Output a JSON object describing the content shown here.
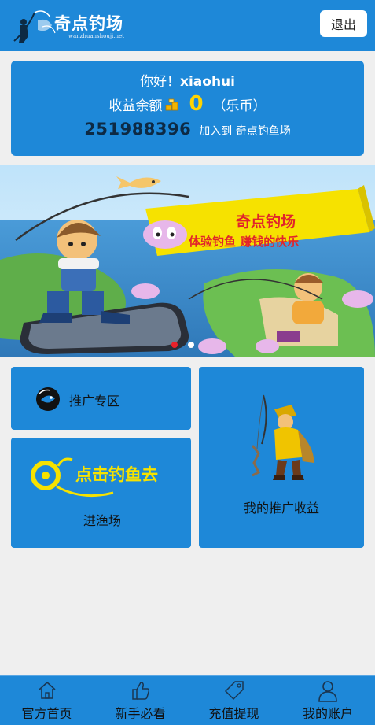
{
  "header": {
    "logo_text": "奇点钓场",
    "logo_subtext": "wanzhuanshouji.net",
    "logout_label": "退出"
  },
  "account": {
    "greeting_prefix": "你好！",
    "username": "xiaohui",
    "balance_label": "收益余额",
    "balance_value": "0",
    "balance_unit": "（乐币）",
    "invite_code": "251988396",
    "invite_text": "加入到 奇点钓鱼场"
  },
  "banner": {
    "headline": "奇点钓场",
    "slogan": "体验钓鱼  赚钱的快乐",
    "active_slide": 0,
    "slide_count": 2
  },
  "tiles": {
    "promo_zone": "推广专区",
    "enter_field_art": "点击钓鱼去",
    "enter_field": "进渔场",
    "my_earnings": "我的推广收益"
  },
  "nav": [
    {
      "label": "官方首页",
      "icon": "home-icon"
    },
    {
      "label": "新手必看",
      "icon": "thumbs-up-icon"
    },
    {
      "label": "充值提现",
      "icon": "tag-icon"
    },
    {
      "label": "我的账户",
      "icon": "user-icon"
    }
  ],
  "colors": {
    "primary": "#1e88d8",
    "background": "#efefef",
    "balance": "#ffd400",
    "banner_yellow": "#f6e200",
    "dot_active": "#e8212a"
  }
}
